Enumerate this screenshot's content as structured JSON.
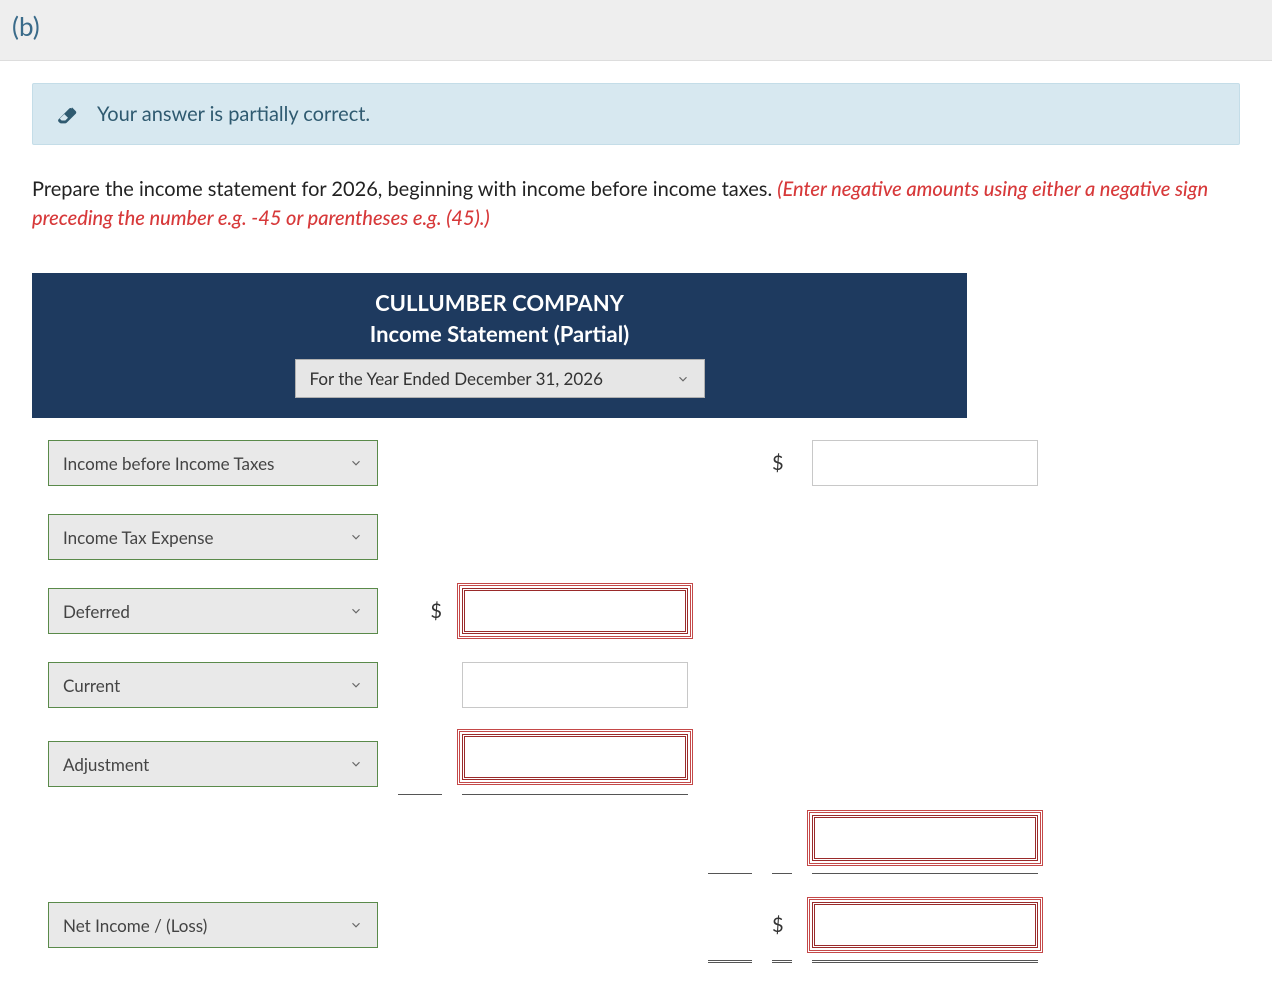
{
  "header": {
    "part_label": "(b)"
  },
  "alert": {
    "icon_name": "eraser-icon",
    "message": "Your answer is partially correct."
  },
  "instruction": {
    "main": "Prepare the income statement for 2026, beginning with income before income taxes. ",
    "note": "(Enter negative amounts using either a negative sign preceding the number e.g. -45 or parentheses e.g. (45).)"
  },
  "statement": {
    "company": "CULLUMBER COMPANY",
    "subtitle": "Income Statement (Partial)",
    "period_selected": "For the Year Ended December 31, 2026"
  },
  "rows": {
    "r1": {
      "label": "Income before Income Taxes",
      "currency": "$",
      "value": ""
    },
    "r2": {
      "label": "Income Tax Expense"
    },
    "r3": {
      "label": "Deferred",
      "currency": "$",
      "value": ""
    },
    "r4": {
      "label": "Current",
      "value": ""
    },
    "r5": {
      "label": "Adjustment",
      "value": ""
    },
    "r6": {
      "value": ""
    },
    "r7": {
      "label": "Net Income / (Loss)",
      "currency": "$",
      "value": ""
    }
  }
}
